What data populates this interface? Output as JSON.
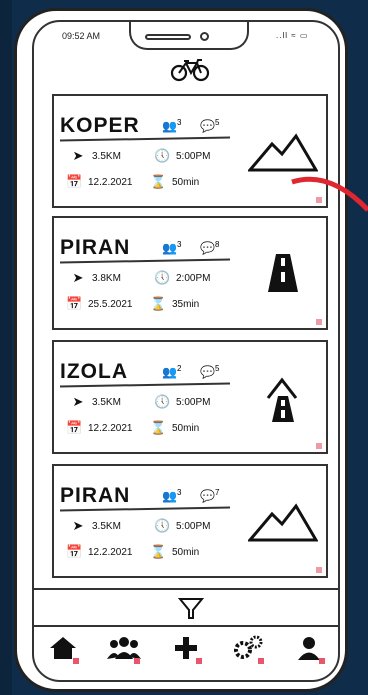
{
  "status": {
    "time": "09:52 AM",
    "icons": "..ll ≈ ▭"
  },
  "app": {
    "logo_icon": "bicycle-icon"
  },
  "rides": [
    {
      "city": "KOPER",
      "people": "3",
      "comments": "5",
      "distance": "3.5KM",
      "time": "5:00PM",
      "date": "12.2.2021",
      "duration": "50min",
      "terrain": "mountain"
    },
    {
      "city": "PIRAN",
      "people": "3",
      "comments": "8",
      "distance": "3.8KM",
      "time": "2:00PM",
      "date": "25.5.2021",
      "duration": "35min",
      "terrain": "road"
    },
    {
      "city": "IZOLA",
      "people": "2",
      "comments": "5",
      "distance": "3.5KM",
      "time": "5:00PM",
      "date": "12.2.2021",
      "duration": "50min",
      "terrain": "mountain-road"
    },
    {
      "city": "PIRAN",
      "people": "3",
      "comments": "7",
      "distance": "3.5KM",
      "time": "5:00PM",
      "date": "12.2.2021",
      "duration": "50min",
      "terrain": "mountain"
    }
  ],
  "nav": [
    "home-icon",
    "group-icon",
    "add-icon",
    "settings-icon",
    "profile-icon"
  ],
  "colors": {
    "background": "#0f2d4a",
    "accent_red": "#e0262e",
    "marker_pink": "#e8566c"
  }
}
